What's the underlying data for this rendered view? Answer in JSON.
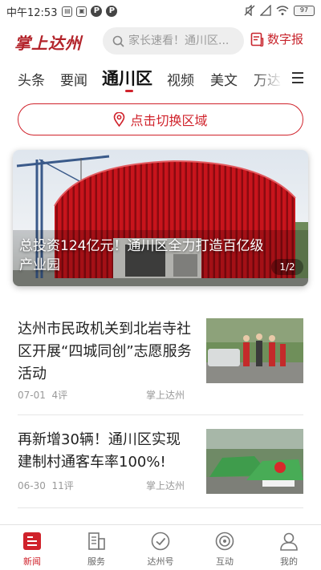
{
  "status_bar": {
    "time": "中午12:53",
    "icon1": "sim-icon",
    "icon2": "album-icon",
    "p1": "P",
    "p2": "P",
    "battery": "97"
  },
  "header": {
    "logo": "掌上达州",
    "search_placeholder": "家长速看！通川区...",
    "digital_label": "数字报"
  },
  "tabs": [
    {
      "label": "头条"
    },
    {
      "label": "要闻"
    },
    {
      "label": "通川区"
    },
    {
      "label": "视频"
    },
    {
      "label": "美文"
    },
    {
      "label": "万达"
    }
  ],
  "region_button": {
    "label": "点击切换区域"
  },
  "banner": {
    "caption": "总投资124亿元！通川区全力打造百亿级产业园",
    "counter": "1/2"
  },
  "news": [
    {
      "title": "达州市民政机关到北岩寺社区开展“四城同创”志愿服务活动",
      "date": "07-01",
      "comments": "4评",
      "source": "掌上达州"
    },
    {
      "title": "再新增30辆！通川区实现建制村通客车率100%!",
      "date": "06-30",
      "comments": "11评",
      "source": "掌上达州"
    }
  ],
  "bottom_nav": [
    {
      "label": "新闻",
      "icon": "news-icon"
    },
    {
      "label": "服务",
      "icon": "building-icon"
    },
    {
      "label": "达州号",
      "icon": "check-circle-icon"
    },
    {
      "label": "互动",
      "icon": "target-icon"
    },
    {
      "label": "我的",
      "icon": "person-icon"
    }
  ],
  "colors": {
    "brand_red": "#d0222b",
    "logo_red": "#b3232a"
  }
}
